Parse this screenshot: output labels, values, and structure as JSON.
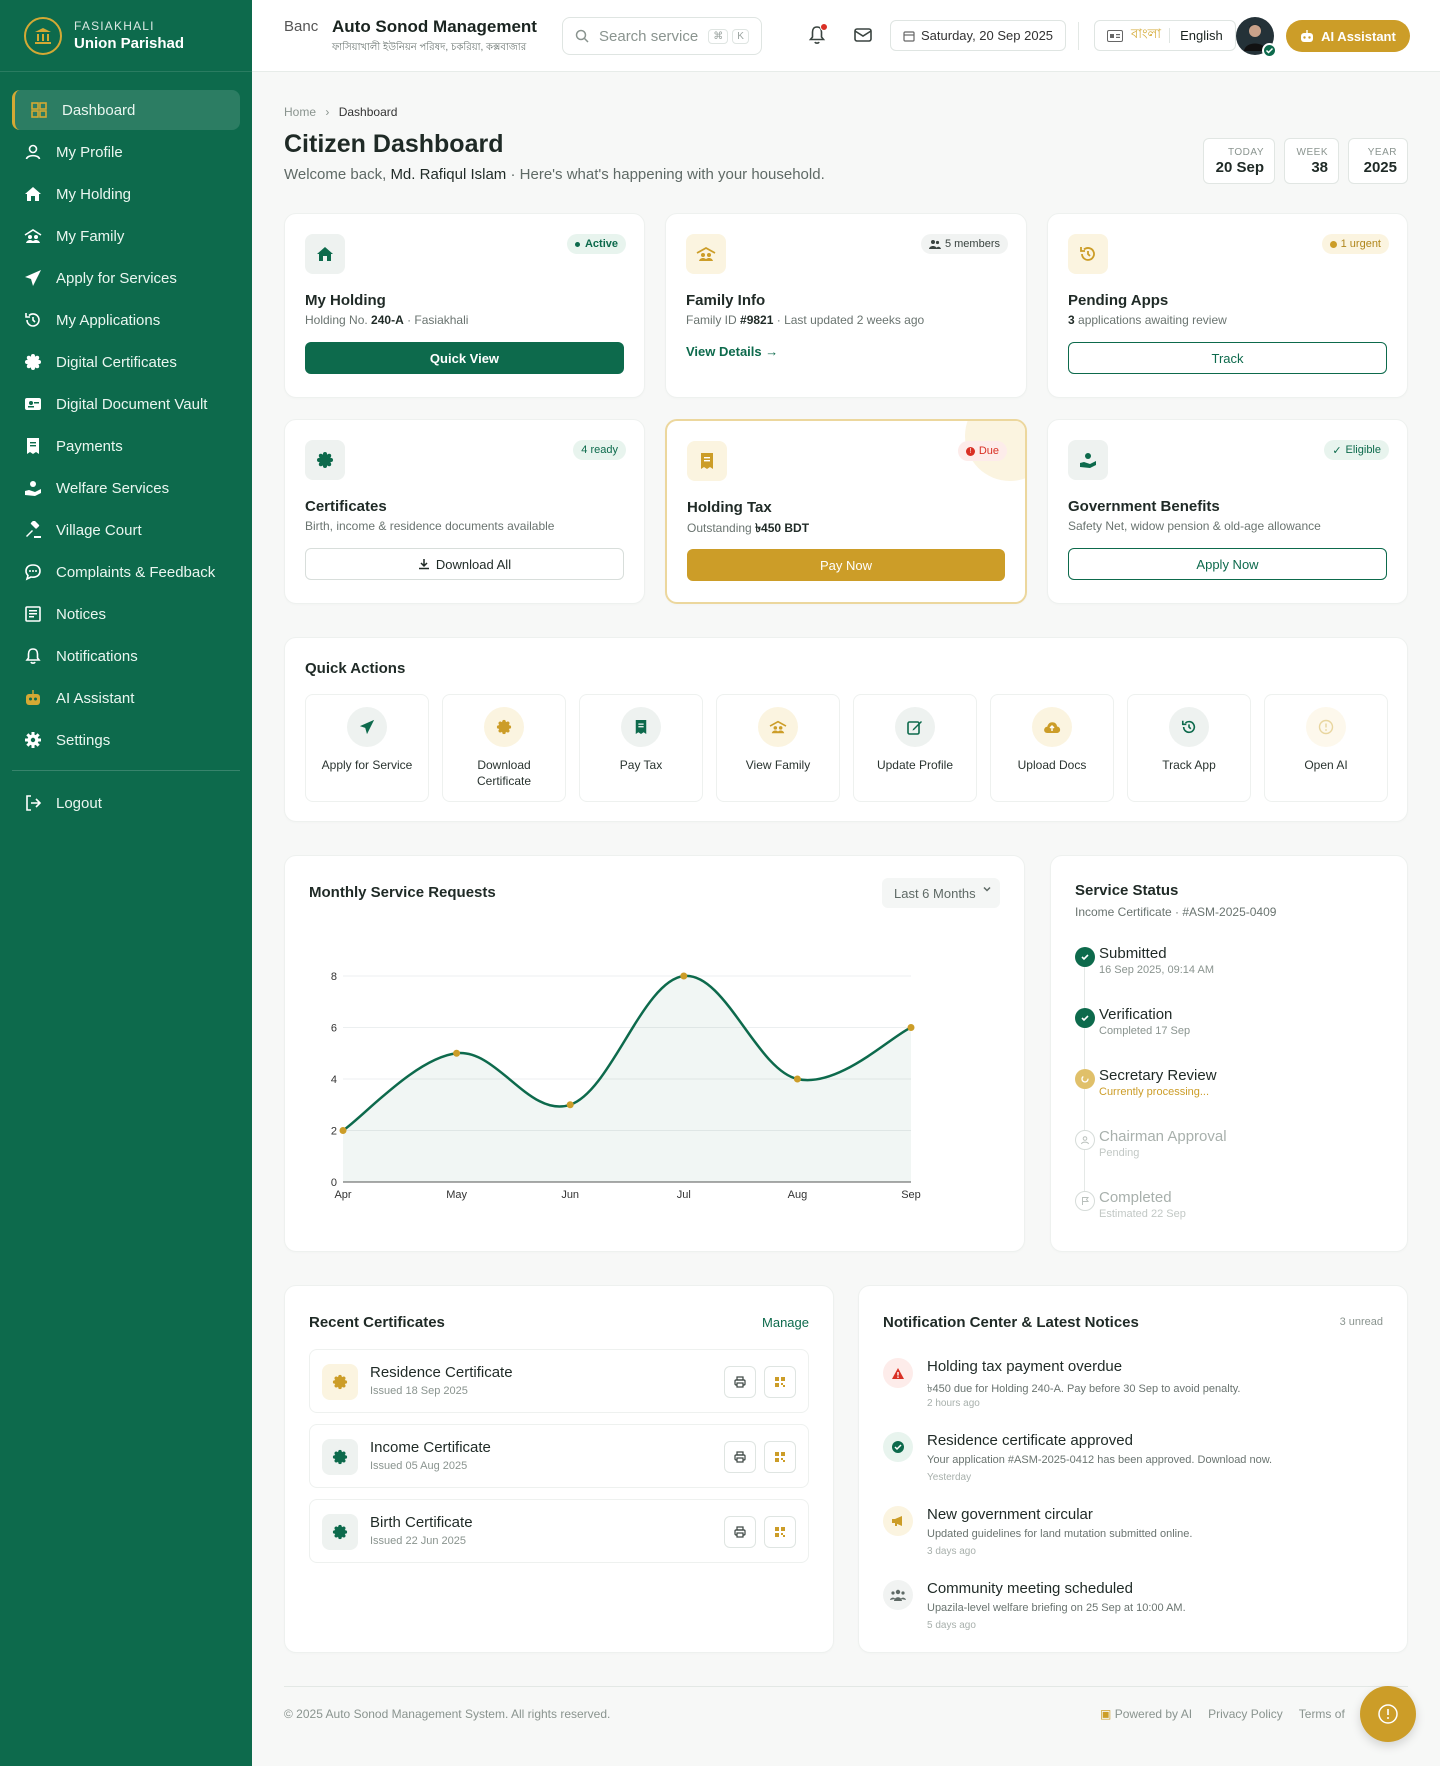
{
  "sidebar": {
    "brand_small": "FASIAKHALI",
    "brand_big": "Union Parishad",
    "items": [
      {
        "label": "Dashboard"
      },
      {
        "label": "My Profile"
      },
      {
        "label": "My Holding"
      },
      {
        "label": "My Family"
      },
      {
        "label": "Apply for Services"
      },
      {
        "label": "My Applications"
      },
      {
        "label": "Digital Certificates"
      },
      {
        "label": "Digital Document Vault"
      },
      {
        "label": "Payments"
      },
      {
        "label": "Welfare Services"
      },
      {
        "label": "Village Court"
      },
      {
        "label": "Complaints & Feedback"
      },
      {
        "label": "Notices"
      },
      {
        "label": "Notifications"
      },
      {
        "label": "AI Assistant"
      },
      {
        "label": "Settings"
      }
    ],
    "logout": "Logout"
  },
  "topbar": {
    "logo_alt": "Banc",
    "title": "Auto Sonod Management",
    "subtitle": "ফাসিয়াখালী ইউনিয়ন পরিষদ, চকরিয়া, কক্সবাজার",
    "search_placeholder": "Search service",
    "kbd1": "⌘",
    "kbd2": "K",
    "date": "Saturday, 20 Sep 2025",
    "lang_bn": "বাংলা",
    "lang_en": "English",
    "ai_button": "AI Assistant"
  },
  "page": {
    "crumb_home": "Home",
    "crumb_current": "Dashboard",
    "title": "Citizen Dashboard",
    "welcome_pre": "Welcome back,",
    "user_name": "Md. Rafiqul Islam",
    "welcome_post": "· Here's what's happening with your household.",
    "stats": [
      {
        "label": "TODAY",
        "value": "20 Sep"
      },
      {
        "label": "WEEK",
        "value": "38"
      },
      {
        "label": "YEAR",
        "value": "2025"
      }
    ]
  },
  "cards": {
    "holding": {
      "badge": "Active",
      "title": "My Holding",
      "sub_pre": "Holding No.",
      "sub_bold": "240-A",
      "sub_post": "· Fasiakhali",
      "button": "Quick View"
    },
    "family": {
      "badge": "5 members",
      "title": "Family Info",
      "sub_pre": "Family ID",
      "sub_bold": "#9821",
      "sub_post": "· Last updated 2 weeks ago",
      "link": "View Details"
    },
    "pending": {
      "badge": "1 urgent",
      "title": "Pending Apps",
      "sub_bold": "3",
      "sub_post": "applications awaiting review",
      "button": "Track"
    },
    "certificates": {
      "badge": "4 ready",
      "title": "Certificates",
      "sub": "Birth, income & residence documents available",
      "button": "Download All"
    },
    "tax": {
      "badge": "Due",
      "title": "Holding Tax",
      "sub_pre": "Outstanding",
      "sub_bold": "৳450 BDT",
      "button": "Pay Now"
    },
    "benefits": {
      "badge": "Eligible",
      "title": "Government Benefits",
      "sub": "Safety Net, widow pension & old-age allowance",
      "button": "Apply Now"
    }
  },
  "quick_actions": {
    "title": "Quick Actions",
    "items": [
      {
        "label": "Apply for Service",
        "icon": "paper-plane-icon"
      },
      {
        "label": "Download Certificate",
        "icon": "certificate-icon"
      },
      {
        "label": "Pay Tax",
        "icon": "receipt-icon"
      },
      {
        "label": "View Family",
        "icon": "family-icon"
      },
      {
        "label": "Update Profile",
        "icon": "edit-icon"
      },
      {
        "label": "Upload Docs",
        "icon": "cloud-upload-icon"
      },
      {
        "label": "Track App",
        "icon": "history-icon"
      },
      {
        "label": "Open AI",
        "icon": "ai-icon"
      }
    ]
  },
  "chart_section": {
    "title": "Monthly Service Requests",
    "range": "Last 6 Months"
  },
  "chart_data": {
    "type": "line",
    "categories": [
      "Apr",
      "May",
      "Jun",
      "Jul",
      "Aug",
      "Sep"
    ],
    "values": [
      2,
      5,
      3,
      8,
      4,
      6
    ],
    "yticks": [
      0,
      2,
      4,
      6,
      8
    ],
    "ylim": [
      0,
      8
    ],
    "title": "Monthly Service Requests",
    "line_color": "#0d6a4c",
    "point_color": "#cc9d28",
    "grid": true
  },
  "service_status": {
    "title": "Service Status",
    "subtitle": "Income Certificate · #ASM-2025-0409",
    "steps": [
      {
        "title": "Submitted",
        "sub": "16 Sep 2025, 09:14 AM",
        "state": "done"
      },
      {
        "title": "Verification",
        "sub": "Completed 17 Sep",
        "state": "done"
      },
      {
        "title": "Secretary Review",
        "sub": "Currently processing...",
        "state": "current"
      },
      {
        "title": "Chairman Approval",
        "sub": "Pending",
        "state": "pending"
      },
      {
        "title": "Completed",
        "sub": "Estimated 22 Sep",
        "state": "pending"
      }
    ]
  },
  "recent_certs": {
    "title": "Recent Certificates",
    "manage": "Manage",
    "items": [
      {
        "name": "Residence Certificate",
        "date": "Issued 18 Sep 2025"
      },
      {
        "name": "Income Certificate",
        "date": "Issued 05 Aug 2025"
      },
      {
        "name": "Birth Certificate",
        "date": "Issued 22 Jun 2025"
      }
    ]
  },
  "notifications": {
    "title": "Notification Center & Latest Notices",
    "unread": "3 unread",
    "items": [
      {
        "title": "Holding tax payment overdue",
        "desc": "৳450 due for Holding 240-A. Pay before 30 Sep to avoid penalty.",
        "time": "2 hours ago"
      },
      {
        "title": "Residence certificate approved",
        "desc": "Your application #ASM-2025-0412 has been approved. Download now.",
        "time": "Yesterday"
      },
      {
        "title": "New government circular",
        "desc": "Updated guidelines for land mutation submitted online.",
        "time": "3 days ago"
      },
      {
        "title": "Community meeting scheduled",
        "desc": "Upazila-level welfare briefing on 25 Sep at 10:00 AM.",
        "time": "5 days ago"
      }
    ]
  },
  "footer": {
    "copyright": "© 2025 Auto Sonod Management System. All rights reserved.",
    "powered": "Powered by AI",
    "privacy": "Privacy Policy",
    "terms": "Terms of"
  },
  "colors": {
    "primary": "#0d6a4c",
    "gold": "#cc9d28",
    "danger": "#d93025"
  }
}
